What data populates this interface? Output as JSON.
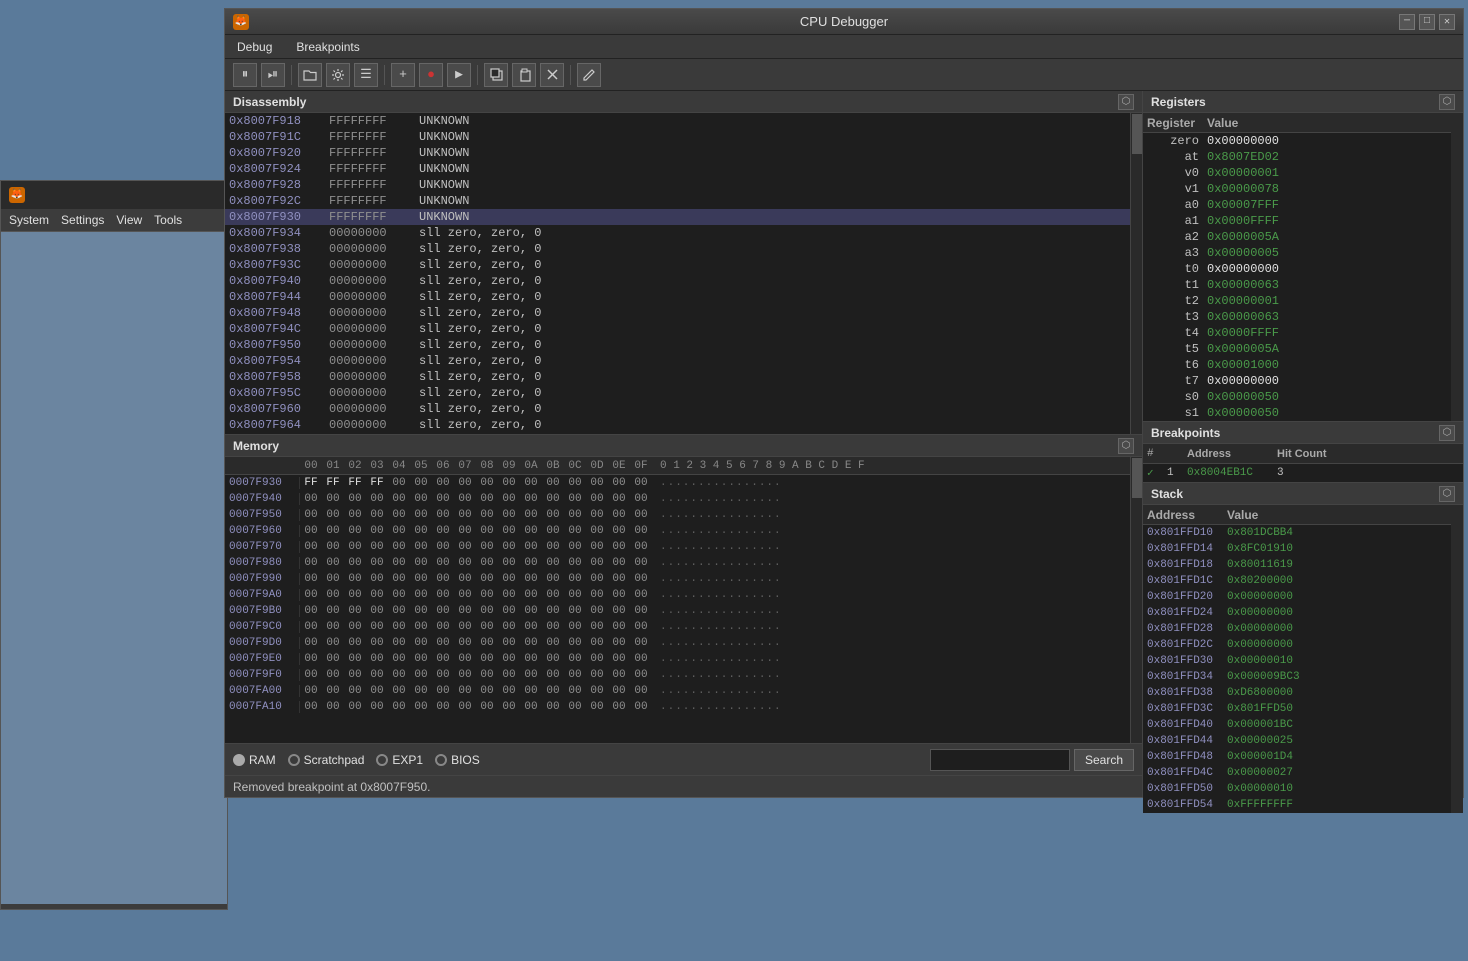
{
  "window": {
    "title": "CPU Debugger",
    "minimize_label": "─",
    "maximize_label": "□",
    "close_label": "✕"
  },
  "menu": {
    "debug_label": "Debug",
    "breakpoints_label": "Breakpoints"
  },
  "toolbar": {
    "pause_label": "⏸",
    "step_label": "⏯",
    "open_label": "📁",
    "settings_label": "⚙",
    "list_label": "☰",
    "add_label": "+",
    "record_label": "●",
    "arrow_label": "▶",
    "copy_label": "⎘",
    "paste_label": "⏋",
    "clear_label": "⌫",
    "edit_label": "✎"
  },
  "panels": {
    "disassembly_label": "Disassembly",
    "memory_label": "Memory",
    "registers_label": "Registers",
    "breakpoints_label": "Breakpoints",
    "stack_label": "Stack"
  },
  "disassembly": {
    "rows": [
      {
        "addr": "0x8007F918",
        "bytes": "FFFFFFFF",
        "instr": "UNKNOWN",
        "highlighted": false
      },
      {
        "addr": "0x8007F91C",
        "bytes": "FFFFFFFF",
        "instr": "UNKNOWN",
        "highlighted": false
      },
      {
        "addr": "0x8007F920",
        "bytes": "FFFFFFFF",
        "instr": "UNKNOWN",
        "highlighted": false
      },
      {
        "addr": "0x8007F924",
        "bytes": "FFFFFFFF",
        "instr": "UNKNOWN",
        "highlighted": false
      },
      {
        "addr": "0x8007F928",
        "bytes": "FFFFFFFF",
        "instr": "UNKNOWN",
        "highlighted": false
      },
      {
        "addr": "0x8007F92C",
        "bytes": "FFFFFFFF",
        "instr": "UNKNOWN",
        "highlighted": false
      },
      {
        "addr": "0x8007F930",
        "bytes": "FFFFFFFF",
        "instr": "UNKNOWN",
        "highlighted": true
      },
      {
        "addr": "0x8007F934",
        "bytes": "00000000",
        "instr": "sll zero, zero, 0",
        "highlighted": false
      },
      {
        "addr": "0x8007F938",
        "bytes": "00000000",
        "instr": "sll zero, zero, 0",
        "highlighted": false
      },
      {
        "addr": "0x8007F93C",
        "bytes": "00000000",
        "instr": "sll zero, zero, 0",
        "highlighted": false
      },
      {
        "addr": "0x8007F940",
        "bytes": "00000000",
        "instr": "sll zero, zero, 0",
        "highlighted": false
      },
      {
        "addr": "0x8007F944",
        "bytes": "00000000",
        "instr": "sll zero, zero, 0",
        "highlighted": false
      },
      {
        "addr": "0x8007F948",
        "bytes": "00000000",
        "instr": "sll zero, zero, 0",
        "highlighted": false
      },
      {
        "addr": "0x8007F94C",
        "bytes": "00000000",
        "instr": "sll zero, zero, 0",
        "highlighted": false
      },
      {
        "addr": "0x8007F950",
        "bytes": "00000000",
        "instr": "sll zero, zero, 0",
        "highlighted": false
      },
      {
        "addr": "0x8007F954",
        "bytes": "00000000",
        "instr": "sll zero, zero, 0",
        "highlighted": false
      },
      {
        "addr": "0x8007F958",
        "bytes": "00000000",
        "instr": "sll zero, zero, 0",
        "highlighted": false
      },
      {
        "addr": "0x8007F95C",
        "bytes": "00000000",
        "instr": "sll zero, zero, 0",
        "highlighted": false
      },
      {
        "addr": "0x8007F960",
        "bytes": "00000000",
        "instr": "sll zero, zero, 0",
        "highlighted": false
      },
      {
        "addr": "0x8007F964",
        "bytes": "00000000",
        "instr": "sll zero, zero, 0",
        "highlighted": false
      }
    ]
  },
  "registers": {
    "header_register": "Register",
    "header_value": "Value",
    "rows": [
      {
        "name": "zero",
        "value": "0x00000000",
        "green": false
      },
      {
        "name": "at",
        "value": "0x8007ED02",
        "green": true
      },
      {
        "name": "v0",
        "value": "0x00000001",
        "green": true
      },
      {
        "name": "v1",
        "value": "0x00000078",
        "green": true
      },
      {
        "name": "a0",
        "value": "0x00007FFF",
        "green": true
      },
      {
        "name": "a1",
        "value": "0x0000FFFF",
        "green": true
      },
      {
        "name": "a2",
        "value": "0x0000005A",
        "green": true
      },
      {
        "name": "a3",
        "value": "0x00000005",
        "green": true
      },
      {
        "name": "t0",
        "value": "0x00000000",
        "green": false
      },
      {
        "name": "t1",
        "value": "0x00000063",
        "green": true
      },
      {
        "name": "t2",
        "value": "0x00000001",
        "green": true
      },
      {
        "name": "t3",
        "value": "0x00000063",
        "green": true
      },
      {
        "name": "t4",
        "value": "0x0000FFFF",
        "green": true
      },
      {
        "name": "t5",
        "value": "0x0000005A",
        "green": true
      },
      {
        "name": "t6",
        "value": "0x00001000",
        "green": true
      },
      {
        "name": "t7",
        "value": "0x00000000",
        "green": false
      },
      {
        "name": "s0",
        "value": "0x00000050",
        "green": true
      },
      {
        "name": "s1",
        "value": "0x00000050",
        "green": true
      }
    ]
  },
  "breakpoints": {
    "header_check": "✓",
    "header_num": "#",
    "header_address": "Address",
    "header_hitcount": "Hit Count",
    "rows": [
      {
        "checked": true,
        "num": "1",
        "addr": "0x8004EB1C",
        "hits": "3"
      }
    ]
  },
  "stack": {
    "header_address": "Address",
    "header_value": "Value",
    "rows": [
      {
        "addr": "0x801FFD10",
        "value": "0x801DCBB4"
      },
      {
        "addr": "0x801FFD14",
        "value": "0x8FC01910"
      },
      {
        "addr": "0x801FFD18",
        "value": "0x80011619"
      },
      {
        "addr": "0x801FFD1C",
        "value": "0x80200000"
      },
      {
        "addr": "0x801FFD20",
        "value": "0x00000000"
      },
      {
        "addr": "0x801FFD24",
        "value": "0x00000000"
      },
      {
        "addr": "0x801FFD28",
        "value": "0x00000000"
      },
      {
        "addr": "0x801FFD2C",
        "value": "0x00000000"
      },
      {
        "addr": "0x801FFD30",
        "value": "0x00000010"
      },
      {
        "addr": "0x801FFD34",
        "value": "0x000009BC3"
      },
      {
        "addr": "0x801FFD38",
        "value": "0xD6800000"
      },
      {
        "addr": "0x801FFD3C",
        "value": "0x801FFD50"
      },
      {
        "addr": "0x801FFD40",
        "value": "0x000001BC"
      },
      {
        "addr": "0x801FFD44",
        "value": "0x00000025"
      },
      {
        "addr": "0x801FFD48",
        "value": "0x000001D4"
      },
      {
        "addr": "0x801FFD4C",
        "value": "0x00000027"
      },
      {
        "addr": "0x801FFD50",
        "value": "0x00000010"
      },
      {
        "addr": "0x801FFD54",
        "value": "0xFFFFFFFF"
      }
    ]
  },
  "memory": {
    "hex_columns": [
      "00",
      "01",
      "02",
      "03",
      "04",
      "05",
      "06",
      "07",
      "08",
      "09",
      "0A",
      "0B",
      "0C",
      "0D",
      "0E",
      "0F"
    ],
    "rows": [
      {
        "addr": "0007F930",
        "cells": [
          "FF",
          "FF",
          "FF",
          "FF",
          "00",
          "00",
          "00",
          "00",
          "00",
          "00",
          "00",
          "00",
          "00",
          "00",
          "00",
          "00"
        ],
        "ascii": "................"
      },
      {
        "addr": "0007F940",
        "cells": [
          "00",
          "00",
          "00",
          "00",
          "00",
          "00",
          "00",
          "00",
          "00",
          "00",
          "00",
          "00",
          "00",
          "00",
          "00",
          "00"
        ],
        "ascii": "................"
      },
      {
        "addr": "0007F950",
        "cells": [
          "00",
          "00",
          "00",
          "00",
          "00",
          "00",
          "00",
          "00",
          "00",
          "00",
          "00",
          "00",
          "00",
          "00",
          "00",
          "00"
        ],
        "ascii": "................"
      },
      {
        "addr": "0007F960",
        "cells": [
          "00",
          "00",
          "00",
          "00",
          "00",
          "00",
          "00",
          "00",
          "00",
          "00",
          "00",
          "00",
          "00",
          "00",
          "00",
          "00"
        ],
        "ascii": "................"
      },
      {
        "addr": "0007F970",
        "cells": [
          "00",
          "00",
          "00",
          "00",
          "00",
          "00",
          "00",
          "00",
          "00",
          "00",
          "00",
          "00",
          "00",
          "00",
          "00",
          "00"
        ],
        "ascii": "................"
      },
      {
        "addr": "0007F980",
        "cells": [
          "00",
          "00",
          "00",
          "00",
          "00",
          "00",
          "00",
          "00",
          "00",
          "00",
          "00",
          "00",
          "00",
          "00",
          "00",
          "00"
        ],
        "ascii": "................"
      },
      {
        "addr": "0007F990",
        "cells": [
          "00",
          "00",
          "00",
          "00",
          "00",
          "00",
          "00",
          "00",
          "00",
          "00",
          "00",
          "00",
          "00",
          "00",
          "00",
          "00"
        ],
        "ascii": "................"
      },
      {
        "addr": "0007F9A0",
        "cells": [
          "00",
          "00",
          "00",
          "00",
          "00",
          "00",
          "00",
          "00",
          "00",
          "00",
          "00",
          "00",
          "00",
          "00",
          "00",
          "00"
        ],
        "ascii": "................"
      },
      {
        "addr": "0007F9B0",
        "cells": [
          "00",
          "00",
          "00",
          "00",
          "00",
          "00",
          "00",
          "00",
          "00",
          "00",
          "00",
          "00",
          "00",
          "00",
          "00",
          "00"
        ],
        "ascii": "................"
      },
      {
        "addr": "0007F9C0",
        "cells": [
          "00",
          "00",
          "00",
          "00",
          "00",
          "00",
          "00",
          "00",
          "00",
          "00",
          "00",
          "00",
          "00",
          "00",
          "00",
          "00"
        ],
        "ascii": "................"
      },
      {
        "addr": "0007F9D0",
        "cells": [
          "00",
          "00",
          "00",
          "00",
          "00",
          "00",
          "00",
          "00",
          "00",
          "00",
          "00",
          "00",
          "00",
          "00",
          "00",
          "00"
        ],
        "ascii": "................"
      },
      {
        "addr": "0007F9E0",
        "cells": [
          "00",
          "00",
          "00",
          "00",
          "00",
          "00",
          "00",
          "00",
          "00",
          "00",
          "00",
          "00",
          "00",
          "00",
          "00",
          "00"
        ],
        "ascii": "................"
      },
      {
        "addr": "0007F9F0",
        "cells": [
          "00",
          "00",
          "00",
          "00",
          "00",
          "00",
          "00",
          "00",
          "00",
          "00",
          "00",
          "00",
          "00",
          "00",
          "00",
          "00"
        ],
        "ascii": "................"
      },
      {
        "addr": "0007FA00",
        "cells": [
          "00",
          "00",
          "00",
          "00",
          "00",
          "00",
          "00",
          "00",
          "00",
          "00",
          "00",
          "00",
          "00",
          "00",
          "00",
          "00"
        ],
        "ascii": "................"
      },
      {
        "addr": "0007FA10",
        "cells": [
          "00",
          "00",
          "00",
          "00",
          "00",
          "00",
          "00",
          "00",
          "00",
          "00",
          "00",
          "00",
          "00",
          "00",
          "00",
          "00"
        ],
        "ascii": "................"
      }
    ]
  },
  "memory_footer": {
    "ram_label": "RAM",
    "scratchpad_label": "Scratchpad",
    "exp1_label": "EXP1",
    "bios_label": "BIOS",
    "search_label": "Search",
    "search_placeholder": ""
  },
  "status": {
    "message": "Removed breakpoint at 0x8007F950."
  }
}
